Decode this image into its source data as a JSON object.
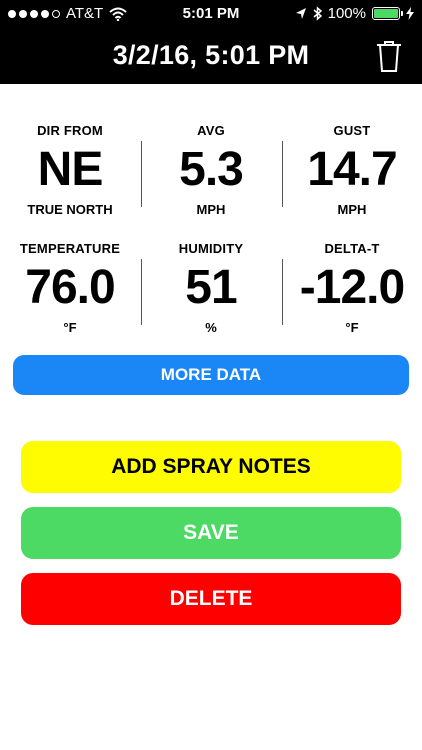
{
  "status_bar": {
    "carrier": "AT&T",
    "time": "5:01 PM",
    "battery": "100%",
    "battery_level": 1.0,
    "signal_bars_filled": 4,
    "signal_bars_total": 5
  },
  "header": {
    "title": "3/2/16, 5:01 PM"
  },
  "readings": {
    "dir": {
      "label": "DIR FROM",
      "value": "NE",
      "unit": "TRUE NORTH"
    },
    "avg": {
      "label": "AVG",
      "value": "5.3",
      "unit": "MPH"
    },
    "gust": {
      "label": "GUST",
      "value": "14.7",
      "unit": "MPH"
    },
    "temperature": {
      "label": "TEMPERATURE",
      "value": "76.0",
      "unit": "°F"
    },
    "humidity": {
      "label": "HUMIDITY",
      "value": "51",
      "unit": "%"
    },
    "delta_t": {
      "label": "DELTA-T",
      "value": "-12.0",
      "unit": "°F"
    }
  },
  "buttons": {
    "more_data": "MORE DATA",
    "add_spray_notes": "ADD SPRAY NOTES",
    "save": "SAVE",
    "delete": "DELETE"
  },
  "colors": {
    "more_data": "#1b86f5",
    "add_spray_notes": "#fffb00",
    "save": "#4cd964",
    "delete": "#ff0000",
    "header": "#000000"
  },
  "icons": {
    "wifi": "wifi-icon",
    "location": "location-arrow-icon",
    "bluetooth": "bluetooth-icon",
    "battery": "battery-icon",
    "charging": "charging-bolt-icon",
    "trash": "trash-icon"
  }
}
